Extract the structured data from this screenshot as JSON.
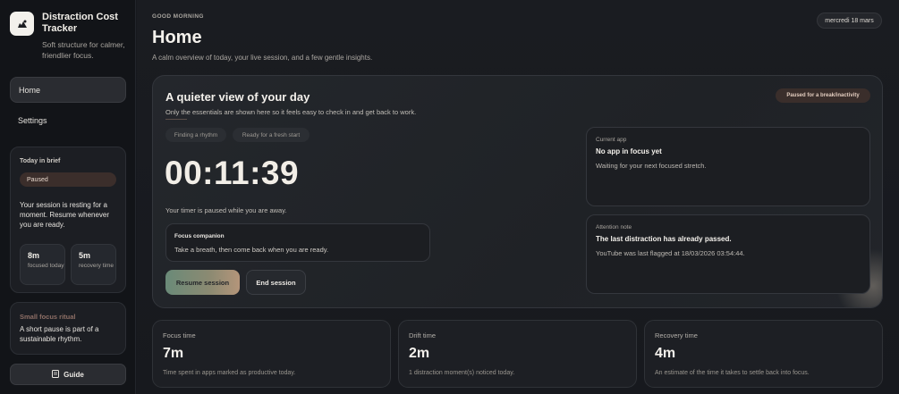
{
  "app": {
    "title": "Distraction Cost Tracker",
    "subtitle": "Soft structure for calmer, friendlier focus."
  },
  "nav": {
    "items": [
      {
        "label": "Home",
        "active": true
      },
      {
        "label": "Settings",
        "active": false
      }
    ]
  },
  "brief": {
    "title": "Today in brief",
    "status": "Paused",
    "message": "Your session is resting for a moment. Resume whenever you are ready.",
    "stats": [
      {
        "value": "8m",
        "label": "focused today"
      },
      {
        "value": "5m",
        "label": "recovery time"
      }
    ]
  },
  "ritual": {
    "title": "Small focus ritual",
    "text": "A short pause is part of a sustainable rhythm."
  },
  "guide": {
    "label": "Guide",
    "icon": "book-icon"
  },
  "header": {
    "greeting": "GOOD MORNING",
    "title": "Home",
    "subtitle": "A calm overview of today, your live session, and a few gentle insights.",
    "date": "mercredi 18 mars"
  },
  "hero": {
    "title": "A quieter view of your day",
    "subtitle": "Only the essentials are shown here so it feels easy to check in and get back to work.",
    "status_badge": "Paused for a break/inactivity",
    "chips": [
      "Finding a rhythm",
      "Ready for a fresh start"
    ],
    "timer": "00:11:39",
    "timer_note": "Your timer is paused while you are away.",
    "companion": {
      "title": "Focus companion",
      "text": "Take a breath, then come back when you are ready."
    },
    "resume_label": "Resume session",
    "end_label": "End session",
    "current_app": {
      "label": "Current app",
      "title": "No app in focus yet",
      "text": "Waiting for your next focused stretch."
    },
    "attention": {
      "label": "Attention note",
      "title": "The last distraction has already passed.",
      "text": "YouTube was last flagged at 18/03/2026 03:54:44."
    }
  },
  "metrics": [
    {
      "label": "Focus time",
      "value": "7m",
      "desc": "Time spent in apps marked as productive today."
    },
    {
      "label": "Drift time",
      "value": "2m",
      "desc": "1 distraction moment(s) noticed today."
    },
    {
      "label": "Recovery time",
      "value": "4m",
      "desc": "An estimate of the time it takes to settle back into focus."
    }
  ],
  "colors": {
    "background": "#16181d",
    "accent_pill": "#3b2e2b",
    "resume_gradient_start": "#6a8a78",
    "resume_gradient_end": "#b4957a"
  }
}
